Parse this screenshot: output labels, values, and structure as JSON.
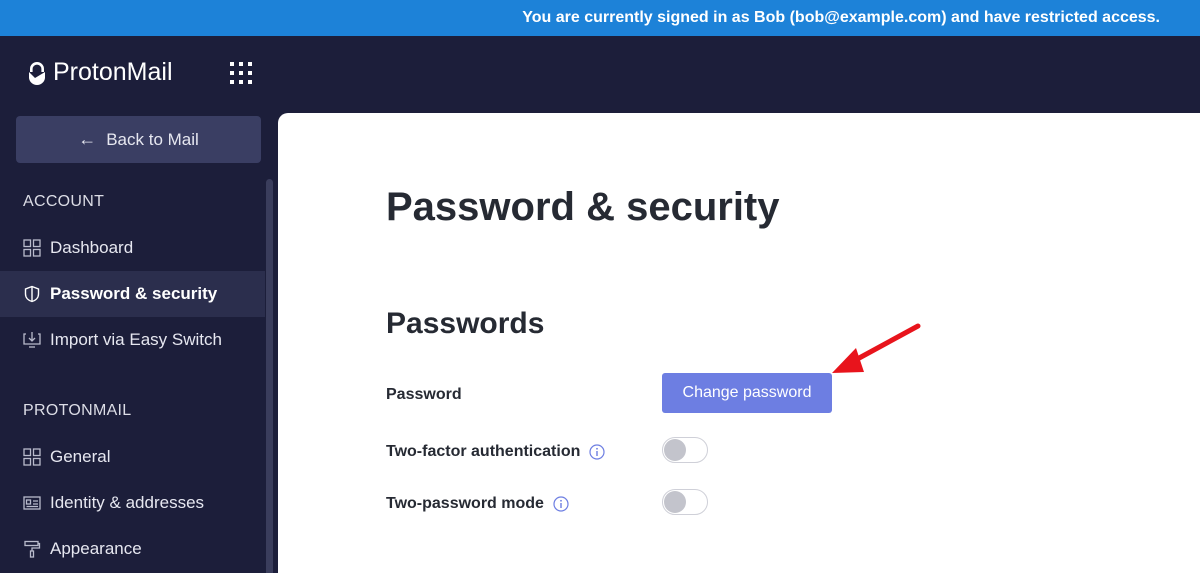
{
  "banner": {
    "text": "You are currently signed in as Bob (bob@example.com) and have restricted access."
  },
  "header": {
    "app_name": "ProtonMail",
    "apps_icon": "grid-icon"
  },
  "sidebar": {
    "back_label": "Back to Mail",
    "account_title": "ACCOUNT",
    "account_items": [
      {
        "label": "Dashboard",
        "icon": "dashboard-icon"
      },
      {
        "label": "Password & security",
        "icon": "shield-icon",
        "active": true
      },
      {
        "label": "Import via Easy Switch",
        "icon": "import-icon"
      }
    ],
    "protonmail_title": "PROTONMAIL",
    "protonmail_items": [
      {
        "label": "General",
        "icon": "dashboard-icon"
      },
      {
        "label": "Identity & addresses",
        "icon": "id-card-icon"
      },
      {
        "label": "Appearance",
        "icon": "paint-roller-icon"
      }
    ]
  },
  "main": {
    "page_title": "Password & security",
    "section_title": "Passwords",
    "rows": [
      {
        "label": "Password",
        "button": "Change password"
      },
      {
        "label": "Two-factor authentication",
        "toggle_on": false
      },
      {
        "label": "Two-password mode",
        "toggle_on": false
      }
    ]
  },
  "colors": {
    "banner": "#1d82d8",
    "sidebar": "#1c1e3a",
    "accent": "#6d7ee2",
    "annotation_arrow": "#e8141c"
  }
}
